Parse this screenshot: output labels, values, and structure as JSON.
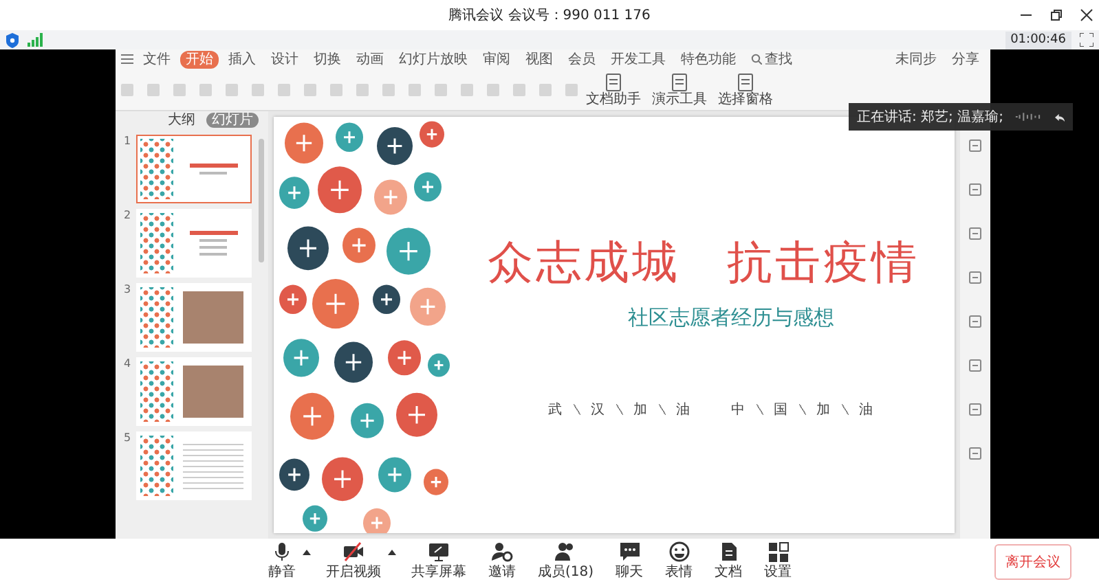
{
  "window": {
    "title": "腾讯会议 会议号：990 011 176",
    "timer": "01:00:46"
  },
  "shared_screen": {
    "ribbon_tabs": [
      {
        "label": "文件",
        "selected": false
      },
      {
        "label": "开始",
        "selected": true
      },
      {
        "label": "插入",
        "selected": false
      },
      {
        "label": "设计",
        "selected": false
      },
      {
        "label": "切换",
        "selected": false
      },
      {
        "label": "动画",
        "selected": false
      },
      {
        "label": "幻灯片放映",
        "selected": false
      },
      {
        "label": "审阅",
        "selected": false
      },
      {
        "label": "视图",
        "selected": false
      },
      {
        "label": "会员",
        "selected": false
      },
      {
        "label": "开发工具",
        "selected": false
      },
      {
        "label": "特色功能",
        "selected": false
      }
    ],
    "search": "查找",
    "sync_status": "未同步",
    "share": "分享",
    "tools": [
      "文档助手",
      "演示工具",
      "选择窗格"
    ],
    "panel_tabs": [
      {
        "label": "大纲",
        "selected": false
      },
      {
        "label": "幻灯片",
        "selected": true
      }
    ],
    "thumbnails": [
      {
        "number": "1",
        "kind": "title",
        "selected": true
      },
      {
        "number": "2",
        "kind": "list",
        "selected": false
      },
      {
        "number": "3",
        "kind": "photo",
        "selected": false
      },
      {
        "number": "4",
        "kind": "photo",
        "selected": false
      },
      {
        "number": "5",
        "kind": "table",
        "selected": false
      }
    ],
    "slide": {
      "title": [
        "众志成城",
        "抗击疫情"
      ],
      "subtitle": "社区志愿者经历与感想",
      "footer": [
        [
          "武",
          "汉",
          "加",
          "油"
        ],
        [
          "中",
          "国",
          "加",
          "油"
        ]
      ]
    }
  },
  "speaking": "正在讲话: 郑艺; 温嘉瑜;",
  "toolbar": [
    {
      "label": "静音",
      "kind": "mic",
      "caret": true
    },
    {
      "label": "开启视频",
      "kind": "video",
      "caret": true
    },
    {
      "label": "共享屏幕",
      "kind": "screen",
      "caret": false
    },
    {
      "label": "邀请",
      "kind": "invite",
      "caret": false
    },
    {
      "label": "成员(18)",
      "kind": "members",
      "caret": false
    },
    {
      "label": "聊天",
      "kind": "chat",
      "caret": false
    },
    {
      "label": "表情",
      "kind": "emoji",
      "caret": false
    },
    {
      "label": "文档",
      "kind": "doc",
      "caret": false
    },
    {
      "label": "设置",
      "kind": "settings",
      "caret": false
    }
  ],
  "leave_button": "离开会议"
}
